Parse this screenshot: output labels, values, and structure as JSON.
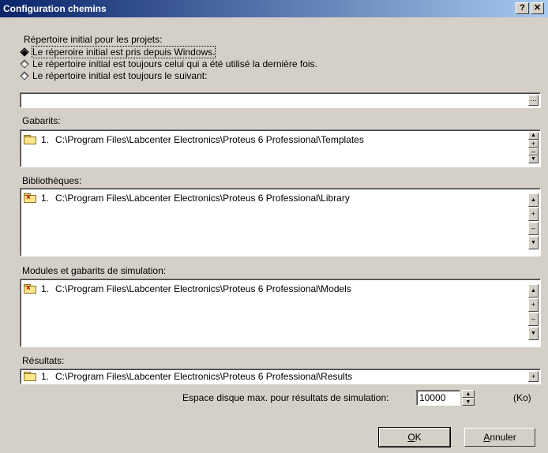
{
  "window": {
    "title": "Configuration chemins",
    "help_label": "?",
    "close_label": "✕"
  },
  "initial_dir": {
    "heading": "Répertoire initial pour les projets:",
    "options": [
      {
        "label": "Le réperoire initial est pris depuis Windows.",
        "checked": true
      },
      {
        "label": "Le répertoire initial est toujours celui qui a été utilisé la dernière fois.",
        "checked": false
      },
      {
        "label": "Le répertoire initial est toujours le suivant:",
        "checked": false
      }
    ],
    "path_value": "",
    "browse_icon": "ellipsis-icon"
  },
  "templates": {
    "heading": "Gabarits:",
    "items": [
      {
        "index": "1.",
        "path": "C:\\Program Files\\Labcenter Electronics\\Proteus 6 Professional\\Templates"
      }
    ]
  },
  "libraries": {
    "heading": "Bibliothèques:",
    "items": [
      {
        "index": "1.",
        "path": "C:\\Program Files\\Labcenter Electronics\\Proteus 6 Professional\\Library"
      }
    ]
  },
  "models": {
    "heading": "Modules et gabarits de simulation:",
    "items": [
      {
        "index": "1.",
        "path": "C:\\Program Files\\Labcenter Electronics\\Proteus 6 Professional\\Models"
      }
    ]
  },
  "results": {
    "heading": "Résultats:",
    "items": [
      {
        "index": "1.",
        "path": "C:\\Program Files\\Labcenter Electronics\\Proteus 6 Professional\\Results"
      }
    ]
  },
  "disk_space": {
    "label": "Espace disque max. pour résultats de simulation:",
    "value": "10000",
    "unit": "(Ko)"
  },
  "buttons": {
    "ok_first": "O",
    "ok_rest": "K",
    "cancel_first": "A",
    "cancel_rest": "nnuler"
  },
  "icons": {
    "scroll_up": "▲",
    "scroll_down": "▼",
    "add": "+",
    "remove": "–"
  }
}
